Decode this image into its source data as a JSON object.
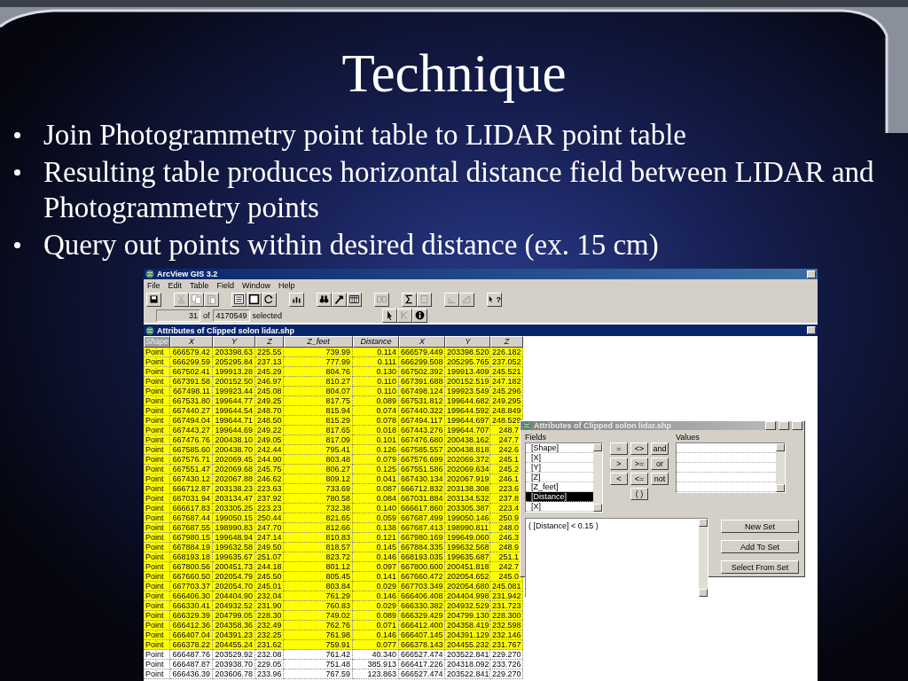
{
  "slide": {
    "title": "Technique",
    "bullets": [
      "Join Photogrammetry point table to LIDAR point table",
      "Resulting table produces horizontal distance field between LIDAR and Photogrammetry points",
      "Query out points within desired distance (ex. 15 cm)"
    ]
  },
  "app": {
    "title": "ArcView GIS 3.2",
    "menu": [
      "File",
      "Edit",
      "Table",
      "Field",
      "Window",
      "Help"
    ],
    "toolbar": [
      {
        "kind": "save",
        "disabled": false
      },
      {
        "kind": "separator"
      },
      {
        "kind": "cut",
        "disabled": true
      },
      {
        "kind": "copy",
        "disabled": true
      },
      {
        "kind": "paste",
        "disabled": true
      },
      {
        "kind": "separator"
      },
      {
        "kind": "list",
        "disabled": false
      },
      {
        "kind": "page",
        "disabled": false
      },
      {
        "kind": "refresh",
        "disabled": false
      },
      {
        "kind": "separator"
      },
      {
        "kind": "chart",
        "disabled": false
      },
      {
        "kind": "separator"
      },
      {
        "kind": "binoculars",
        "disabled": false
      },
      {
        "kind": "hammer",
        "disabled": false
      },
      {
        "kind": "grid",
        "disabled": false
      },
      {
        "kind": "separator"
      },
      {
        "kind": "join",
        "disabled": true
      },
      {
        "kind": "separator"
      },
      {
        "kind": "sum",
        "disabled": false
      },
      {
        "kind": "blank",
        "disabled": true
      },
      {
        "kind": "separator"
      },
      {
        "kind": "histogram",
        "disabled": true
      },
      {
        "kind": "stairs",
        "disabled": true
      },
      {
        "kind": "separator"
      },
      {
        "kind": "help",
        "disabled": false,
        "label": "?"
      }
    ],
    "status": {
      "count": "31",
      "of": "of",
      "total": "4170549",
      "suffix": "selected"
    },
    "tools": [
      {
        "kind": "pointer"
      },
      {
        "kind": "select"
      },
      {
        "kind": "info"
      }
    ]
  },
  "table": {
    "title": "Attributes of Clipped solon lidar.shp",
    "columns": [
      {
        "label": "Shape",
        "kind": "shape"
      },
      {
        "label": "X",
        "kind": "field"
      },
      {
        "label": "Y",
        "kind": "field"
      },
      {
        "label": "Z",
        "kind": "field"
      },
      {
        "label": "Z_feet",
        "kind": "field"
      },
      {
        "label": "Distance",
        "kind": "field"
      },
      {
        "label": "X",
        "kind": "field"
      },
      {
        "label": "Y",
        "kind": "field"
      },
      {
        "label": "Z",
        "kind": "field"
      }
    ],
    "rows": [
      {
        "selected": true,
        "cells": [
          "Point",
          "666579.42",
          "203398.63",
          "225.55",
          "739.99",
          "0.114",
          "666579.449",
          "203398.520",
          "226.182"
        ]
      },
      {
        "selected": true,
        "cells": [
          "Point",
          "666299.59",
          "205295.84",
          "237.13",
          "777.99",
          "0.111",
          "666299.508",
          "205295.765",
          "237.052"
        ]
      },
      {
        "selected": true,
        "cells": [
          "Point",
          "667502.41",
          "199913.28",
          "245.29",
          "804.76",
          "0.130",
          "667502.392",
          "199913.409",
          "245.521"
        ]
      },
      {
        "selected": true,
        "cells": [
          "Point",
          "667391.58",
          "200152.50",
          "246.97",
          "810.27",
          "0.110",
          "667391.688",
          "200152.519",
          "247.182"
        ]
      },
      {
        "selected": true,
        "cells": [
          "Point",
          "667498.11",
          "199923.44",
          "245.08",
          "804.07",
          "0.110",
          "667498.124",
          "199923.549",
          "245.296"
        ]
      },
      {
        "selected": true,
        "cells": [
          "Point",
          "667531.80",
          "199644.77",
          "249.25",
          "817.75",
          "0.089",
          "667531.812",
          "199644.682",
          "249.295"
        ]
      },
      {
        "selected": true,
        "cells": [
          "Point",
          "667440.27",
          "199644.54",
          "248.70",
          "815.94",
          "0.074",
          "667440.322",
          "199644.592",
          "248.849"
        ]
      },
      {
        "selected": true,
        "cells": [
          "Point",
          "667494.04",
          "199644.71",
          "248.50",
          "815.29",
          "0.078",
          "667494.117",
          "199644.697",
          "248.529"
        ]
      },
      {
        "selected": true,
        "cells": [
          "Point",
          "667443.27",
          "199644.69",
          "249.22",
          "817.65",
          "0.018",
          "667443.276",
          "199644.707",
          "248.7"
        ]
      },
      {
        "selected": true,
        "cells": [
          "Point",
          "667476.76",
          "200438.10",
          "249.05",
          "817.09",
          "0.101",
          "667476.680",
          "200438.162",
          "247.7"
        ]
      },
      {
        "selected": true,
        "cells": [
          "Point",
          "667585.60",
          "200438.70",
          "242.44",
          "795.41",
          "0.126",
          "667585.557",
          "200438.818",
          "242.6"
        ]
      },
      {
        "selected": true,
        "cells": [
          "Point",
          "667576.71",
          "202069.45",
          "244.90",
          "803.48",
          "0.079",
          "667576.699",
          "202069.372",
          "245.1"
        ]
      },
      {
        "selected": true,
        "cells": [
          "Point",
          "667551.47",
          "202069.68",
          "245.75",
          "806.27",
          "0.125",
          "667551.586",
          "202069.634",
          "245.2"
        ]
      },
      {
        "selected": true,
        "cells": [
          "Point",
          "667430.12",
          "202067.88",
          "246.62",
          "809.12",
          "0.041",
          "667430.134",
          "202067.919",
          "246.1"
        ]
      },
      {
        "selected": true,
        "cells": [
          "Point",
          "666712.87",
          "203138.23",
          "223.63",
          "733.69",
          "0.087",
          "666712.832",
          "203138.308",
          "223.6"
        ]
      },
      {
        "selected": true,
        "cells": [
          "Point",
          "667031.94",
          "203134.47",
          "237.92",
          "780.58",
          "0.084",
          "667031.884",
          "203134.532",
          "237.8"
        ]
      },
      {
        "selected": true,
        "cells": [
          "Point",
          "666617.83",
          "203305.25",
          "223.23",
          "732.38",
          "0.140",
          "666617.860",
          "203305.387",
          "223.4"
        ]
      },
      {
        "selected": true,
        "cells": [
          "Point",
          "667687.44",
          "199050.15",
          "250.44",
          "821.65",
          "0.059",
          "667687.499",
          "199050.146",
          "250.9"
        ]
      },
      {
        "selected": true,
        "cells": [
          "Point",
          "667687.55",
          "198990.83",
          "247.70",
          "812.66",
          "0.138",
          "667687.413",
          "198990.811",
          "248.0"
        ]
      },
      {
        "selected": true,
        "cells": [
          "Point",
          "667980.15",
          "199648.94",
          "247.14",
          "810.83",
          "0.121",
          "667980.169",
          "199649.060",
          "246.3"
        ]
      },
      {
        "selected": true,
        "cells": [
          "Point",
          "667884.19",
          "199632.58",
          "249.50",
          "818.57",
          "0.145",
          "667884.335",
          "199632.568",
          "248.9"
        ]
      },
      {
        "selected": true,
        "cells": [
          "Point",
          "668193.18",
          "199635.67",
          "251.07",
          "823.72",
          "0.146",
          "668193.035",
          "199635.687",
          "251.1"
        ]
      },
      {
        "selected": true,
        "cells": [
          "Point",
          "667800.56",
          "200451.73",
          "244.18",
          "801.12",
          "0.097",
          "667800.600",
          "200451.818",
          "242.7"
        ]
      },
      {
        "selected": true,
        "cells": [
          "Point",
          "667660.50",
          "202054.79",
          "245.50",
          "805.45",
          "0.141",
          "667660.472",
          "202054.652",
          "245.0"
        ]
      },
      {
        "selected": true,
        "cells": [
          "Point",
          "667703.37",
          "202054.70",
          "245.01",
          "803.84",
          "0.029",
          "667703.349",
          "202054.680",
          "245.081"
        ]
      },
      {
        "selected": true,
        "cells": [
          "Point",
          "666406.30",
          "204404.90",
          "232.04",
          "761.29",
          "0.146",
          "666406.408",
          "204404.998",
          "231.942"
        ]
      },
      {
        "selected": true,
        "cells": [
          "Point",
          "666330.41",
          "204932.52",
          "231.90",
          "760.83",
          "0.029",
          "666330.382",
          "204932.529",
          "231.723"
        ]
      },
      {
        "selected": true,
        "cells": [
          "Point",
          "666329.39",
          "204799.05",
          "228.30",
          "749.02",
          "0.089",
          "666329.429",
          "204799.130",
          "228.300"
        ]
      },
      {
        "selected": true,
        "cells": [
          "Point",
          "666412.36",
          "204358.36",
          "232.49",
          "762.76",
          "0.071",
          "666412.400",
          "204358.419",
          "232.598"
        ]
      },
      {
        "selected": true,
        "cells": [
          "Point",
          "666407.04",
          "204391.23",
          "232.25",
          "761.98",
          "0.146",
          "666407.145",
          "204391.129",
          "232.146"
        ]
      },
      {
        "selected": true,
        "cells": [
          "Point",
          "666378.22",
          "204455.24",
          "231.62",
          "759.91",
          "0.077",
          "666378.143",
          "204455.232",
          "231.767"
        ]
      },
      {
        "selected": false,
        "cells": [
          "Point",
          "666487.76",
          "203529.92",
          "232.08",
          "761.42",
          "40.340",
          "666527.474",
          "203522.841",
          "229.270"
        ]
      },
      {
        "selected": false,
        "cells": [
          "Point",
          "666487.87",
          "203938.70",
          "229.05",
          "751.48",
          "385.913",
          "666417.226",
          "204318.092",
          "233.726"
        ]
      },
      {
        "selected": false,
        "cells": [
          "Point",
          "666436.39",
          "203606.78",
          "233.96",
          "767.59",
          "123.863",
          "666527.474",
          "203522.841",
          "229.270"
        ]
      }
    ]
  },
  "dialog": {
    "title": "Attributes of Clipped solon lidar.shp",
    "fields_label": "Fields",
    "fields": [
      {
        "label": "[Shape]",
        "selected": false
      },
      {
        "label": "[X]",
        "selected": false
      },
      {
        "label": "[Y]",
        "selected": false
      },
      {
        "label": "[Z]",
        "selected": false
      },
      {
        "label": "[Z_feet]",
        "selected": false
      },
      {
        "label": "[Distance]",
        "selected": true
      },
      {
        "label": "[X]",
        "selected": false
      }
    ],
    "operators": [
      "=",
      "<>",
      "and",
      ">",
      ">=",
      "or",
      "<",
      "<=",
      "not",
      "( )"
    ],
    "values_label": "Values",
    "expression": "( [Distance] < 0.15 )",
    "buttons": [
      "New Set",
      "Add To Set",
      "Select From Set"
    ]
  }
}
